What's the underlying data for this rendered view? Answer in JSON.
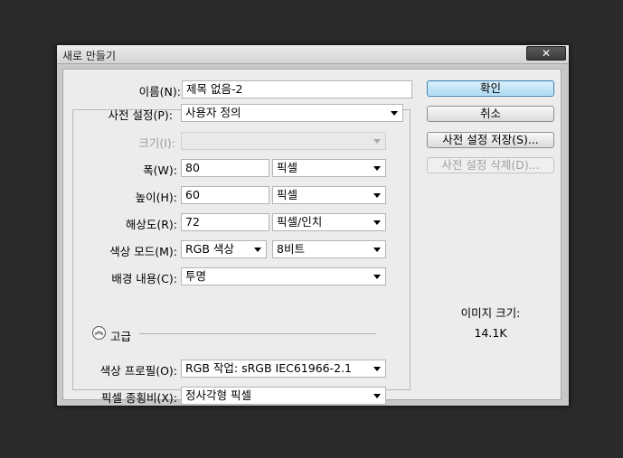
{
  "window": {
    "title": "새로 만들기",
    "close_glyph": "✕"
  },
  "form": {
    "name": {
      "label": "이름(N):",
      "value": "제목 없음-2"
    },
    "preset": {
      "label": "사전 설정(P):",
      "value": "사용자 정의"
    },
    "size": {
      "label": "크기(I):",
      "value": ""
    },
    "width": {
      "label": "폭(W):",
      "value": "80",
      "unit": "픽셀"
    },
    "height": {
      "label": "높이(H):",
      "value": "60",
      "unit": "픽셀"
    },
    "resolution": {
      "label": "해상도(R):",
      "value": "72",
      "unit": "픽셀/인치"
    },
    "color_mode": {
      "label": "색상 모드(M):",
      "value": "RGB 색상",
      "depth": "8비트"
    },
    "background": {
      "label": "배경 내용(C):",
      "value": "투명"
    },
    "advanced": {
      "label": "고급",
      "icon": "collapse-up-icon"
    },
    "color_profile": {
      "label": "색상 프로필(O):",
      "value": "RGB 작업: sRGB IEC61966-2.1"
    },
    "pixel_aspect": {
      "label": "픽셀 종횡비(X):",
      "value": "정사각형 픽셀"
    }
  },
  "buttons": {
    "ok": "확인",
    "cancel": "취소",
    "save_preset": "사전 설정 저장(S)...",
    "delete_preset": "사전 설정 삭제(D)..."
  },
  "image_size": {
    "label": "이미지 크기:",
    "value": "14.1K"
  }
}
